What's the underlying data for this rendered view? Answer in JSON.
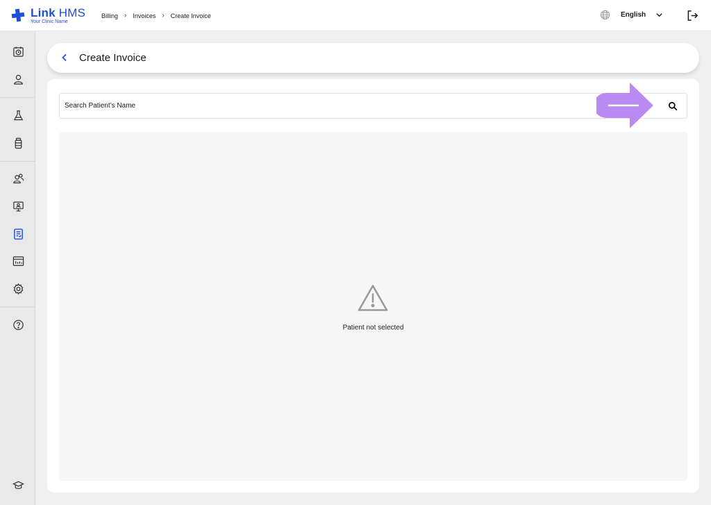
{
  "brand": {
    "name_part1": "Link",
    "name_part2": "HMS",
    "subtitle": "Your Clinic Name",
    "accent_color": "#1d4fd8"
  },
  "breadcrumb": [
    {
      "label": "Billing"
    },
    {
      "label": "Invoices"
    },
    {
      "label": "Create Invoice"
    }
  ],
  "topbar": {
    "language": "English",
    "icons": [
      "globe-icon",
      "chevron-down-icon",
      "logout-icon"
    ]
  },
  "sidebar": {
    "items": [
      {
        "icon": "appointments-icon",
        "active": false
      },
      {
        "icon": "patient-icon",
        "active": false
      },
      {
        "icon": "lab-flask-icon",
        "active": false
      },
      {
        "icon": "pharmacy-bottle-icon",
        "active": false
      },
      {
        "icon": "staff-icon",
        "active": false
      },
      {
        "icon": "telemedicine-icon",
        "active": false
      },
      {
        "icon": "billing-icon",
        "active": true
      },
      {
        "icon": "reports-icon",
        "active": false
      },
      {
        "icon": "settings-icon",
        "active": false
      },
      {
        "icon": "help-icon",
        "active": false
      },
      {
        "icon": "training-icon",
        "active": false
      }
    ]
  },
  "page": {
    "title": "Create Invoice"
  },
  "search": {
    "placeholder": "Search Patient’s Name",
    "callout_color": "#b98af2"
  },
  "empty_state": {
    "icon": "warning-icon",
    "message": "Patient not selected"
  }
}
